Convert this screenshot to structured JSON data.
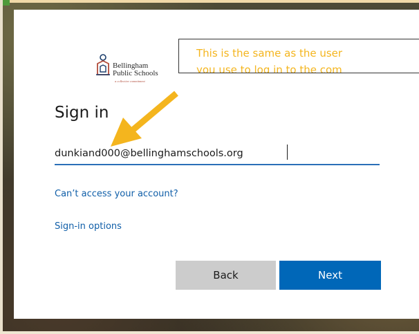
{
  "logo": {
    "line1": "Bellingham",
    "line2": "Public Schools",
    "tagline": "a collective commitment"
  },
  "signin": {
    "title": "Sign in",
    "email_value": "dunkiand000@bellinghamschools.org",
    "cant_access_link": "Can’t access your account?",
    "options_link": "Sign-in options",
    "back_label": "Back",
    "next_label": "Next"
  },
  "callout": {
    "line1": "This is the same as the user",
    "line2": "you use to log in to the com"
  },
  "colors": {
    "accent": "#0067b8",
    "link": "#0f5ea8",
    "callout_text": "#f4b51e",
    "arrow": "#f4b51e"
  },
  "icons": {
    "logo_mark": "school-logo-icon",
    "arrow": "annotation-arrow-icon"
  }
}
